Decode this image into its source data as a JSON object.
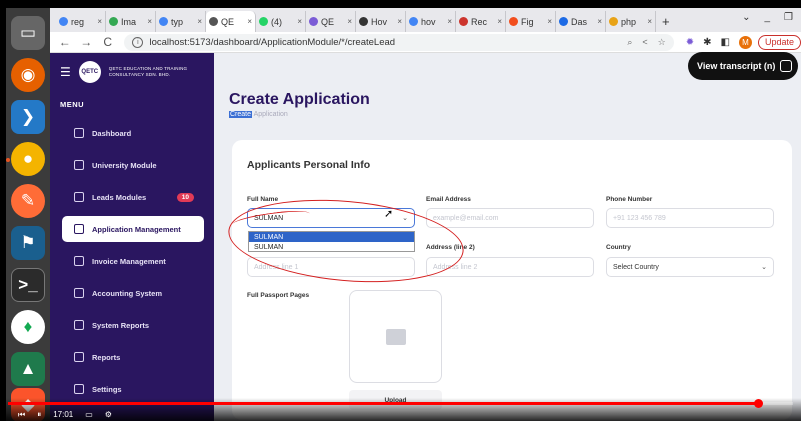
{
  "browser": {
    "tabs": [
      {
        "label": "reg",
        "icon": "google-icon",
        "color": "#4285f4"
      },
      {
        "label": "Ima",
        "icon": "image-icon",
        "color": "#34a853"
      },
      {
        "label": "typ",
        "icon": "google-icon",
        "color": "#4285f4"
      },
      {
        "label": "QE",
        "icon": "globe-icon",
        "color": "#555555",
        "active": true
      },
      {
        "label": "(4)",
        "icon": "whatsapp-icon",
        "color": "#25d366"
      },
      {
        "label": "QE",
        "icon": "gear-icon",
        "color": "#7b5cd6"
      },
      {
        "label": "Hov",
        "icon": "infinity-icon",
        "color": "#333333"
      },
      {
        "label": "hov",
        "icon": "google-icon",
        "color": "#4285f4"
      },
      {
        "label": "Rec",
        "icon": "ruby-icon",
        "color": "#cc342d"
      },
      {
        "label": "Fig",
        "icon": "figma-icon",
        "color": "#f24e1e"
      },
      {
        "label": "Das",
        "icon": "vercel-icon",
        "color": "#1d6ae5"
      },
      {
        "label": "php",
        "icon": "pencil-icon",
        "color": "#e8a317"
      }
    ],
    "new_tab": "+",
    "url": "localhost:5173/dashboard/ApplicationModule/*/createLead",
    "profile_initial": "M",
    "update_label": "Update"
  },
  "sidebar": {
    "brand_text": "QETC EDUCATION AND TRAINING CONSULTANCY SDN. BHD.",
    "logo_text": "QETC",
    "menu_title": "MENU",
    "items": [
      {
        "label": "Dashboard"
      },
      {
        "label": "University Module"
      },
      {
        "label": "Leads Modules",
        "badge": "10"
      },
      {
        "label": "Application Management",
        "active": true
      },
      {
        "label": "Invoice Management"
      },
      {
        "label": "Accounting System"
      },
      {
        "label": "System Reports"
      },
      {
        "label": "Reports"
      },
      {
        "label": "Settings"
      }
    ]
  },
  "main": {
    "title": "Create Application",
    "breadcrumb_highlight": "Create",
    "breadcrumb_rest": " Application",
    "section_title": "Applicants Personal Info",
    "fields": {
      "full_name_label": "Full Name",
      "full_name_value": "SULMAN",
      "email_label": "Email Address",
      "email_placeholder": "example@email.com",
      "phone_label": "Phone Number",
      "phone_placeholder": "+91 123 456 789",
      "address1_placeholder": "Address line 1",
      "address2_label": "Address (line 2)",
      "address2_placeholder": "Address line 2",
      "country_label": "Country",
      "country_value": "Select Country",
      "passport_label": "Full Passport Pages",
      "upload_label": "Upload"
    },
    "autocomplete": [
      "SULMAN",
      "SULMAN"
    ]
  },
  "overlay": {
    "transcript_label": "View transcript (n)",
    "video_progress": 0.955,
    "video_time": "17:01"
  }
}
